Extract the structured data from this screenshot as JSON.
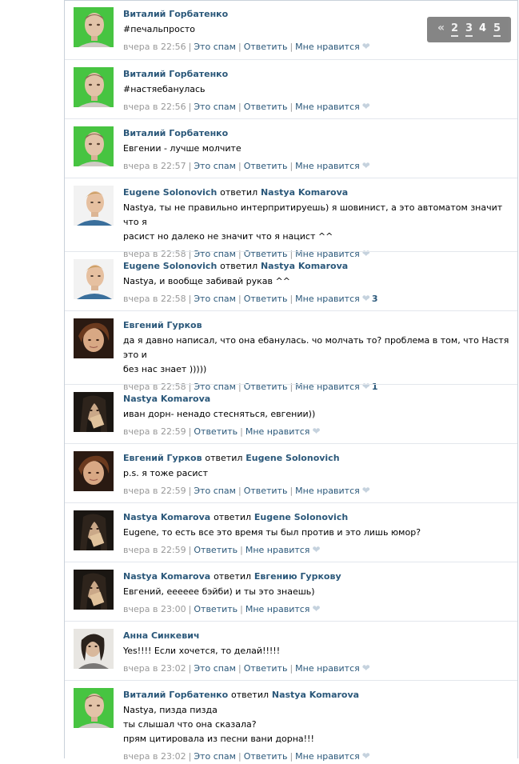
{
  "pager": {
    "arrow": "«",
    "pages": [
      "2",
      "3",
      "4",
      "5"
    ],
    "current": "4"
  },
  "labels": {
    "spam": "Это спам",
    "reply": "Ответить",
    "like": "Мне нравится",
    "separator": "|"
  },
  "posts": [
    {
      "author": "Виталий Горбатенко",
      "replied_word": "",
      "replied_to": "",
      "avatar": "green-guy-avatar",
      "lines": [
        "#печальпросто"
      ],
      "time": "вчера в 22:56",
      "spam": true,
      "likes": ""
    },
    {
      "author": "Виталий Горбатенко",
      "replied_word": "",
      "replied_to": "",
      "avatar": "green-guy-avatar",
      "lines": [
        "#настяебанулась"
      ],
      "time": "вчера в 22:56",
      "spam": true,
      "likes": ""
    },
    {
      "author": "Виталий Горбатенко",
      "replied_word": "",
      "replied_to": "",
      "avatar": "green-guy-avatar",
      "lines": [
        "Евгении - лучше молчите"
      ],
      "time": "вчера в 22:57",
      "spam": true,
      "likes": ""
    },
    {
      "author": "Eugene Solonovich",
      "replied_word": "ответил",
      "replied_to": "Nastya Komarova",
      "avatar": "blond-guy-avatar",
      "lines": [
        "Nastya, ты не правильно интерпритируешь) я шовинист, а это автоматом значит что я",
        "расист но далеко не значит что я нацист ^^"
      ],
      "time": "вчера в 22:58",
      "spam": true,
      "likes": ""
    },
    {
      "author": "Eugene Solonovich",
      "replied_word": "ответил",
      "replied_to": "Nastya Komarova",
      "avatar": "blond-guy-avatar",
      "lines": [
        "Nastya, и вообще забивай рукав ^^"
      ],
      "time": "вчера в 22:58",
      "spam": true,
      "likes": "3"
    },
    {
      "author": "Евгений Гурков",
      "replied_word": "",
      "replied_to": "",
      "avatar": "brown-hair-avatar",
      "lines": [
        "да я давно написал, что она ебанулась. чо молчать то? проблема в том, что Настя это и",
        "без нас знает )))))"
      ],
      "time": "вчера в 22:58",
      "spam": true,
      "likes": "1"
    },
    {
      "author": "Nastya Komarova",
      "replied_word": "",
      "replied_to": "",
      "avatar": "dark-girl-avatar",
      "lines": [
        "иван дорн- ненадо стесняться, евгении))"
      ],
      "time": "вчера в 22:59",
      "spam": false,
      "likes": ""
    },
    {
      "author": "Евгений Гурков",
      "replied_word": "ответил",
      "replied_to": "Eugene Solonovich",
      "avatar": "brown-hair-avatar",
      "lines": [
        "p.s. я тоже расист"
      ],
      "time": "вчера в 22:59",
      "spam": true,
      "likes": ""
    },
    {
      "author": "Nastya Komarova",
      "replied_word": "ответил",
      "replied_to": "Eugene Solonovich",
      "avatar": "dark-girl-avatar",
      "lines": [
        "Eugene, то есть все это время ты был против и это лишь юмор?"
      ],
      "time": "вчера в 22:59",
      "spam": false,
      "likes": ""
    },
    {
      "author": "Nastya Komarova",
      "replied_word": "ответил",
      "replied_to": "Евгению Гуркову",
      "avatar": "dark-girl-avatar",
      "lines": [
        "Евгений, ееееее бэйби) и ты это знаешь)"
      ],
      "time": "вчера в 23:00",
      "spam": false,
      "likes": ""
    },
    {
      "author": "Анна Синкевич",
      "replied_word": "",
      "replied_to": "",
      "avatar": "anna-avatar",
      "lines": [
        "Yes!!!! Если хочется, то делай!!!!!"
      ],
      "time": "вчера в 23:02",
      "spam": true,
      "likes": ""
    },
    {
      "author": "Виталий Горбатенко",
      "replied_word": "ответил",
      "replied_to": "Nastya Komarova",
      "avatar": "green-guy-avatar",
      "lines": [
        "Nastya, пизда пизда",
        "ты слышал что она сказала?",
        "прям цитировала из песни вани дорна!!!"
      ],
      "time": "вчера в 23:02",
      "spam": true,
      "likes": ""
    }
  ]
}
